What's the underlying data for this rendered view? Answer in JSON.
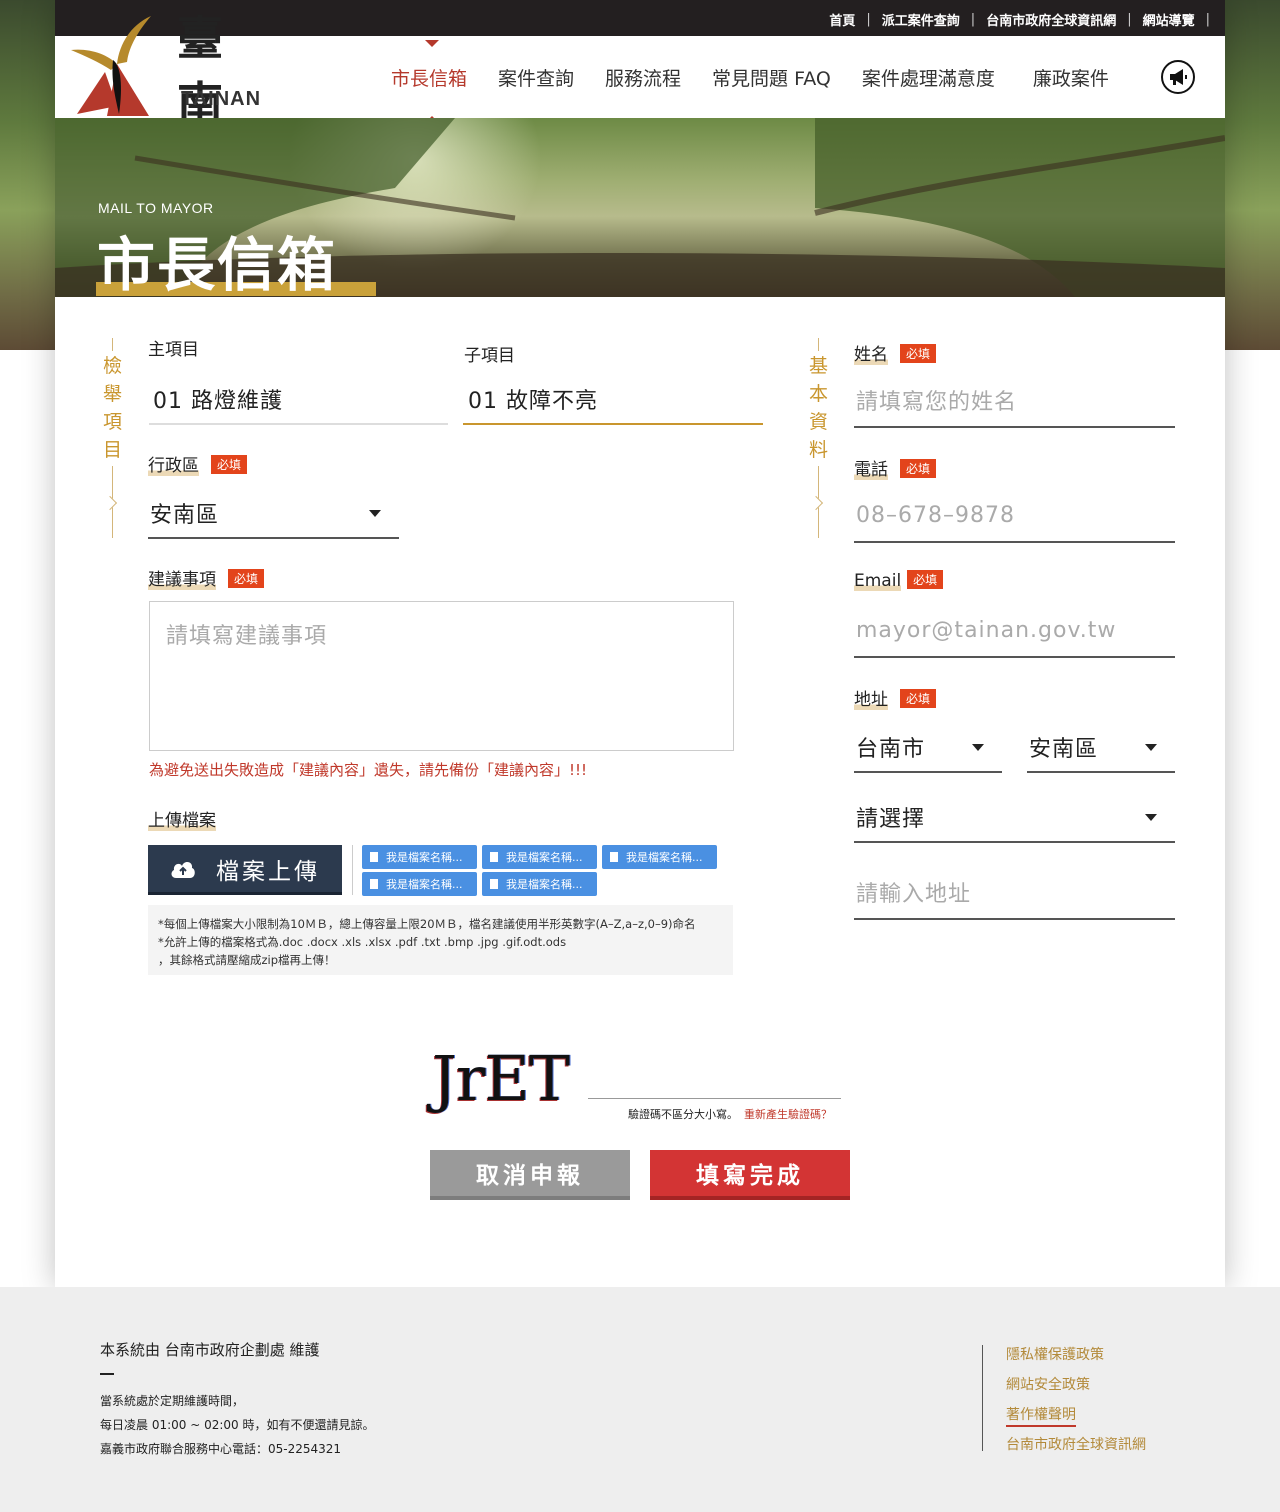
{
  "topbar": {
    "links": [
      "首頁",
      "派工案件查詢",
      "台南市政府全球資訊網",
      "網站導覽"
    ]
  },
  "logo": {
    "han": "臺南",
    "latin": "TAINAN"
  },
  "nav": {
    "items": [
      "市長信箱",
      "案件查詢",
      "服務流程",
      "常見問題 FAQ",
      "案件處理滿意度",
      "廉政案件"
    ],
    "active_index": 0,
    "icon": "megaphone-icon"
  },
  "banner": {
    "subtitle": "MAIL TO MAYOR",
    "title": "市長信箱"
  },
  "report_section": {
    "label": "檢舉項目",
    "main_item": {
      "label": "主項目",
      "value": "01 路燈維護"
    },
    "sub_item": {
      "label": "子項目",
      "value": "01 故障不亮"
    },
    "district": {
      "label": "行政區",
      "required": "必填",
      "value": "安南區"
    },
    "suggestion": {
      "label": "建議事項",
      "required": "必填",
      "placeholder": "請填寫建議事項"
    },
    "warning": "為避免送出失敗造成「建議內容」遺失，請先備份「建議內容」!!!",
    "upload": {
      "label": "上傳檔案",
      "button": "檔案上傳",
      "files": [
        "我是檔案名稱...",
        "我是檔案名稱...",
        "我是檔案名稱...",
        "我是檔案名稱...",
        "我是檔案名稱..."
      ],
      "notes": [
        "*每個上傳檔案大小限制為10ＭＢ，總上傳容量上限20ＭＢ，檔名建議使用半形英數字(A–Z,a–z,0–9)命名",
        "*允許上傳的檔案格式為.doc .docx .xls .xlsx .pdf .txt .bmp .jpg .gif.odt.ods",
        "，其餘格式請壓縮成zip檔再上傳！"
      ]
    }
  },
  "basic_section": {
    "label": "基本資料",
    "name": {
      "label": "姓名",
      "required": "必填",
      "placeholder": "請填寫您的姓名"
    },
    "phone": {
      "label": "電話",
      "required": "必填",
      "placeholder": "08–678–9878"
    },
    "email": {
      "label": "Email",
      "required": "必填",
      "placeholder": "mayor@tainan.gov.tw"
    },
    "address": {
      "label": "地址",
      "required": "必填",
      "city": "台南市",
      "district": "安南區",
      "area": "請選擇",
      "placeholder": "請輸入地址"
    }
  },
  "captcha": {
    "code": "JrET",
    "hint": "驗證碼不區分大小寫。",
    "regenerate": "重新產生驗證碼？"
  },
  "actions": {
    "cancel": "取消申報",
    "submit": "填寫完成"
  },
  "footer": {
    "maintained": "本系統由 台南市政府企劃處 維護",
    "info": [
      "當系統處於定期維護時間，",
      "每日凌晨 01:00 ~ 02:00 時，如有不便還請見諒。",
      "嘉義市政府聯合服務中心電話：05-2254321"
    ],
    "links": [
      "隱私權保護政策",
      "網站安全政策",
      "著作權聲明",
      "台南市政府全球資訊網"
    ]
  },
  "colors": {
    "accent_red": "#b5392c",
    "gold": "#c9962e",
    "required": "#e3441b",
    "dark_button": "#2c3a4e",
    "submit": "#d33434"
  }
}
